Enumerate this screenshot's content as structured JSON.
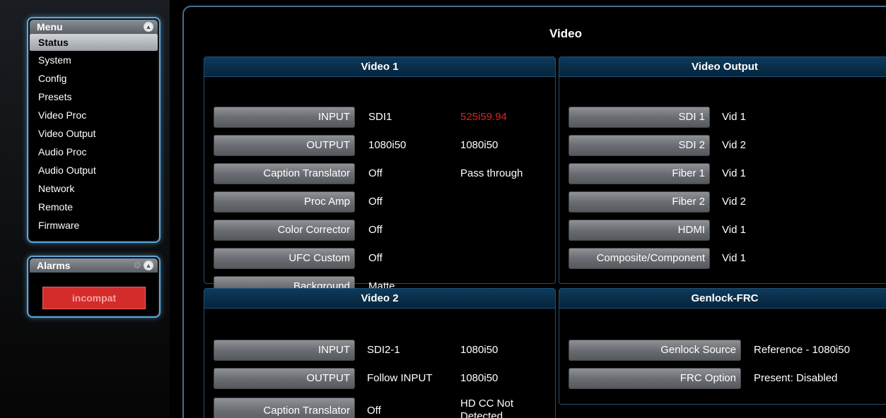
{
  "menu": {
    "title": "Menu",
    "items": [
      "Status",
      "System",
      "Config",
      "Presets",
      "Video Proc",
      "Video Output",
      "Audio Proc",
      "Audio Output",
      "Network",
      "Remote",
      "Firmware"
    ]
  },
  "alarms": {
    "title": "Alarms",
    "button": "incompat",
    "button_color": "#d42b2b"
  },
  "page": {
    "title": "Video"
  },
  "video1": {
    "title": "Video 1",
    "rows": [
      {
        "label": "INPUT",
        "value": "SDI1",
        "status": "525i59.94",
        "status_color": "#e02020"
      },
      {
        "label": "OUTPUT",
        "value": "1080i50",
        "status": "1080i50"
      },
      {
        "label": "Caption Translator",
        "value": "Off",
        "status": "Pass through"
      },
      {
        "label": "Proc Amp",
        "value": "Off",
        "status": ""
      },
      {
        "label": "Color Corrector",
        "value": "Off",
        "status": ""
      },
      {
        "label": "UFC Custom",
        "value": "Off",
        "status": ""
      },
      {
        "label": "Background",
        "value": "Matte",
        "status": ""
      }
    ]
  },
  "video_output": {
    "title": "Video Output",
    "rows": [
      {
        "label": "SDI 1",
        "value": "Vid 1"
      },
      {
        "label": "SDI 2",
        "value": "Vid 2"
      },
      {
        "label": "Fiber 1",
        "value": "Vid 1"
      },
      {
        "label": "Fiber 2",
        "value": "Vid 2"
      },
      {
        "label": "HDMI",
        "value": "Vid 1"
      },
      {
        "label": "Composite/Component",
        "value": "Vid 1"
      }
    ]
  },
  "video2": {
    "title": "Video 2",
    "rows": [
      {
        "label": "INPUT",
        "value": "SDI2-1",
        "status": "1080i50"
      },
      {
        "label": "OUTPUT",
        "value": "Follow INPUT",
        "status": "1080i50"
      },
      {
        "label": "Caption Translator",
        "value": "Off",
        "status": "HD CC Not Detected"
      }
    ]
  },
  "genlock": {
    "title": "Genlock-FRC",
    "rows": [
      {
        "label": "Genlock Source",
        "value": "Reference - 1080i50"
      },
      {
        "label": "FRC Option",
        "value": "Present: Disabled"
      }
    ]
  },
  "icons": {
    "collapse": "chevron-up-icon",
    "settings": "gear-icon"
  }
}
